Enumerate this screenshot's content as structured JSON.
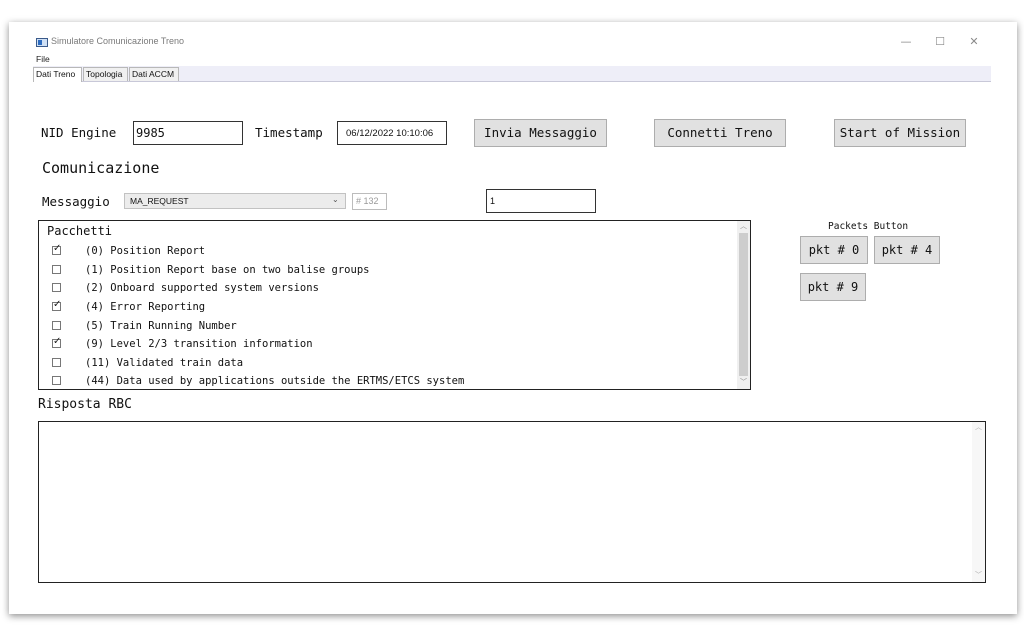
{
  "window": {
    "title": "Simulatore Comunicazione Treno",
    "controls": {
      "minimize": "—",
      "maximize": "☐",
      "close": "✕"
    }
  },
  "menu": {
    "file": "File"
  },
  "tabs": [
    {
      "label": "Dati Treno",
      "active": true
    },
    {
      "label": "Topologia",
      "active": false
    },
    {
      "label": "Dati ACCM",
      "active": false
    }
  ],
  "header": {
    "nid_label": "NID Engine",
    "nid_value": "9985",
    "timestamp_label": "Timestamp",
    "timestamp_value": "06/12/2022 10:10:06",
    "send_button": "Invia Messaggio",
    "connect_button": "Connetti Treno",
    "start_button": "Start of Mission"
  },
  "comunicazione": {
    "title": "Comunicazione",
    "message_label": "Messaggio",
    "message_selected": "MA_REQUEST",
    "message_number": "# 132",
    "extra_value": "1"
  },
  "packets": {
    "title": "Pacchetti",
    "items": [
      {
        "label": "(0) Position Report",
        "checked": true
      },
      {
        "label": "(1) Position Report base on two balise groups",
        "checked": false
      },
      {
        "label": "(2) Onboard supported system versions",
        "checked": false
      },
      {
        "label": "(4) Error Reporting",
        "checked": true
      },
      {
        "label": "(5) Train Running Number",
        "checked": false
      },
      {
        "label": "(9) Level 2/3 transition information",
        "checked": true
      },
      {
        "label": "(11) Validated train data",
        "checked": false
      },
      {
        "label": "(44) Data used by applications outside the ERTMS/ETCS system",
        "checked": false
      }
    ]
  },
  "packets_button": {
    "title": "Packets Button",
    "buttons": [
      "pkt # 0",
      "pkt # 4",
      "pkt # 9"
    ]
  },
  "risposta": {
    "title": "Risposta RBC",
    "text": ""
  },
  "colors": {
    "tabstrip": "#eeeef8",
    "button": "#e1e1e1",
    "border": "#222222"
  }
}
